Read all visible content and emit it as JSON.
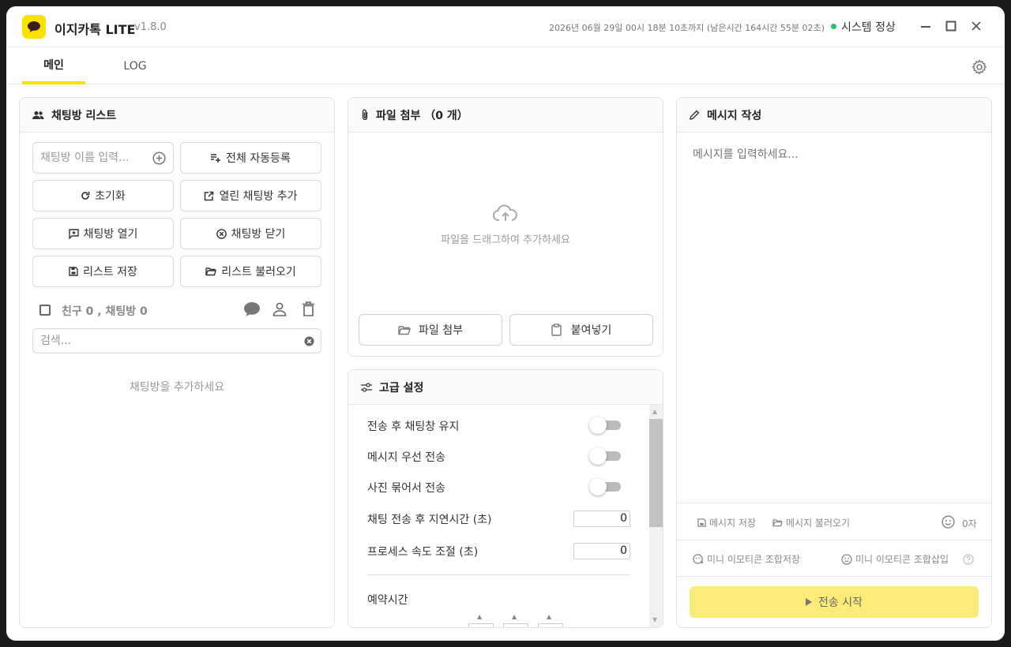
{
  "app": {
    "title": "이지카톡 LITE",
    "version": "v1.8.0"
  },
  "status": {
    "expire": "2026년 06월 29일 00시 18분 10초까지 (남은시간 164시간 55분 02초)",
    "system": "시스템 정상",
    "dot_color": "#22c55e"
  },
  "tabs": [
    {
      "label": "메인",
      "active": true
    },
    {
      "label": "LOG",
      "active": false
    }
  ],
  "chat_list": {
    "title": "채팅방 리스트",
    "name_placeholder": "채팅방 이름 입력...",
    "buttons": {
      "register_all": "전체 자동등록",
      "reset": "초기화",
      "add_open": "열린 채팅방 추가",
      "open_room": "채팅방 열기",
      "close_room": "채팅방 닫기",
      "save_list": "리스트 저장",
      "load_list": "리스트 불러오기"
    },
    "count_text": "친구 0 , 채팅방 0",
    "search_placeholder": "검색...",
    "empty_text": "채팅방을 추가하세요"
  },
  "attach": {
    "title": "파일 첨부 （0 개）",
    "drop_text": "파일을 드래그하여 추가하세요",
    "attach_button": "파일 첨부",
    "paste_button": "붙여넣기"
  },
  "advanced": {
    "title": "고급 설정",
    "toggles": [
      {
        "label": "전송 후 채팅창 유지",
        "on": false
      },
      {
        "label": "메시지 우선 전송",
        "on": false
      },
      {
        "label": "사진 묶어서 전송",
        "on": false
      }
    ],
    "numbers": [
      {
        "label": "채팅 전송 후 지연시간 (초)",
        "value": "0"
      },
      {
        "label": "프로세스 속도 조절 (초)",
        "value": "0"
      }
    ],
    "schedule_label": "예약시간"
  },
  "message": {
    "title": "메시지 작성",
    "placeholder": "메시지를 입력하세요...",
    "save": "메시지 저장",
    "load": "메시지 불러오기",
    "char_count": "0자",
    "emoji_save": "미니 이모티콘 조합저장",
    "emoji_insert": "미니 이모티콘 조합삽입",
    "send_button": "전송 시작"
  },
  "colors": {
    "accent": "#fae100",
    "send_button": "#fbec7a"
  },
  "icons": [
    "chat-bubble-icon",
    "users-icon",
    "plus-circle-icon",
    "playlist-add-icon",
    "refresh-icon",
    "external-link-icon",
    "chat-add-icon",
    "close-circle-icon",
    "save-icon",
    "folder-open-icon",
    "speech-bubble-icon",
    "person-icon",
    "trash-icon",
    "clear-icon",
    "paperclip-icon",
    "cloud-upload-icon",
    "folder-icon",
    "clipboard-icon",
    "sliders-icon",
    "pencil-icon",
    "smile-icon",
    "emoji-save-icon",
    "help-icon",
    "play-icon",
    "gear-icon",
    "minimize-icon",
    "maximize-icon",
    "close-icon"
  ]
}
